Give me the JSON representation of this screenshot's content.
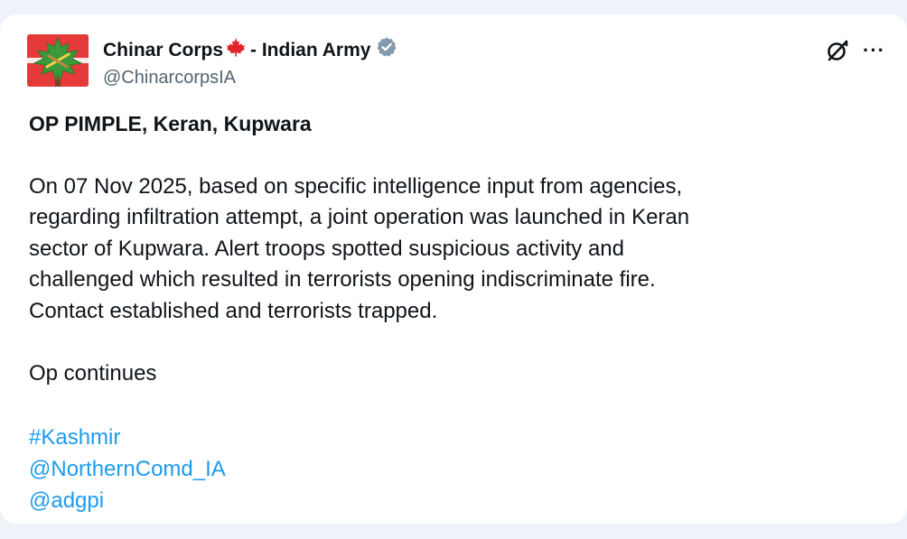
{
  "post": {
    "author": {
      "name_part1": "Chinar Corps",
      "name_part2": "- Indian Army",
      "handle": "@ChinarcorpsIA",
      "verified": true
    },
    "title": "OP PIMPLE, Keran, Kupwara",
    "paragraph_lines": [
      "On 07 Nov 2025, based on specific intelligence input from agencies,",
      "regarding infiltration attempt, a joint operation was launched in Keran",
      "sector of Kupwara. Alert troops spotted suspicious activity and",
      "challenged which resulted in terrorists opening indiscriminate fire.",
      "Contact established and terrorists trapped."
    ],
    "status_line": "Op continues",
    "tags": [
      "#Kashmir",
      "@NorthernComd_IA",
      "@adgpi"
    ]
  },
  "icons": {
    "avatar": "chinar-leaf-logo",
    "name_emoji": "maple-leaf-icon",
    "verified": "verified-badge-icon",
    "grok": "grok-icon",
    "more": "more-icon"
  },
  "colors": {
    "background": "#eef2f9",
    "card": "#ffffff",
    "text": "#0f1419",
    "secondary_text": "#536471",
    "link": "#1d9bf0",
    "avatar_red": "#e63a3a",
    "leaf_green": "#3a9a3a",
    "verified_gray": "#829aab"
  }
}
